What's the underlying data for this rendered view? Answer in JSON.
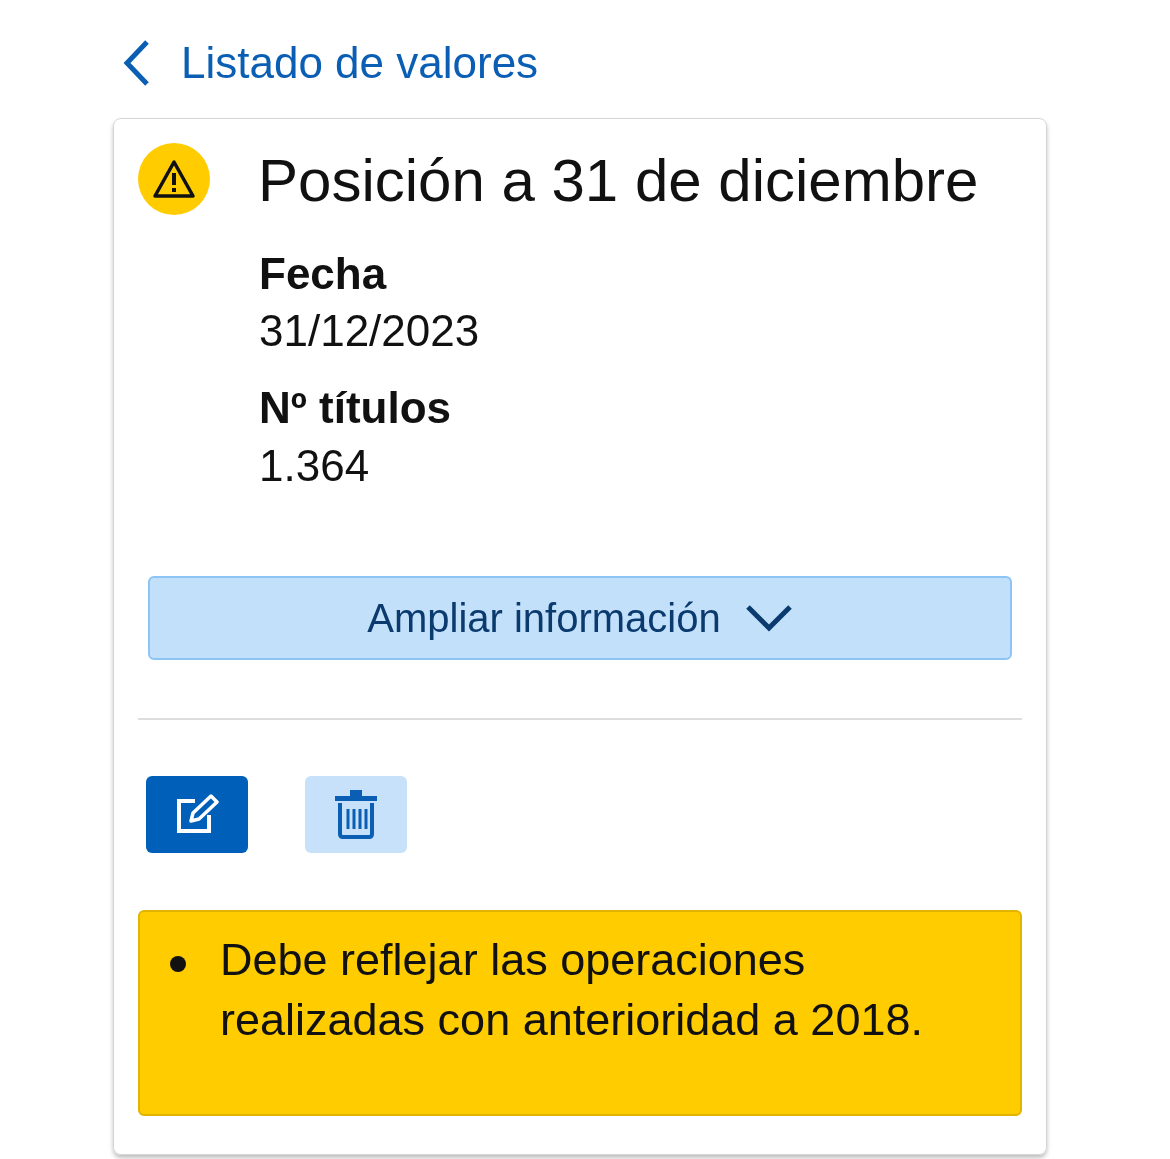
{
  "back_link": {
    "label": "Listado de valores"
  },
  "card": {
    "title": "Posición a 31 de diciembre",
    "warning": true,
    "fields": [
      {
        "label": "Fecha",
        "value": "31/12/2023"
      },
      {
        "label": "Nº títulos",
        "value": "1.364"
      }
    ],
    "expand_button": {
      "label": "Ampliar información",
      "expanded": false
    },
    "actions": [
      {
        "kind": "edit"
      },
      {
        "kind": "delete"
      }
    ],
    "notices": [
      "Debe reflejar las operaciones realizadas con anterioridad a 2018."
    ]
  }
}
